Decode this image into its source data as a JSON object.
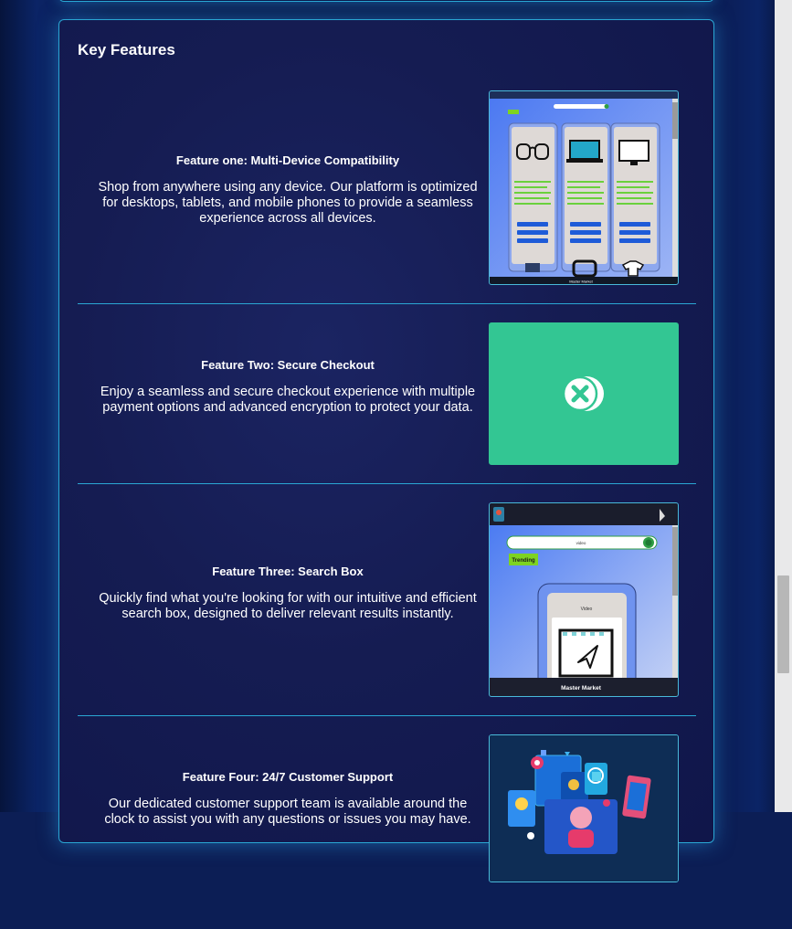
{
  "section": {
    "title": "Key Features"
  },
  "features": [
    {
      "title": "Feature one: Multi-Device Compatibility",
      "description": "Shop from anywhere using any device. Our platform is optimized for desktops, tablets, and mobile phones to provide a seamless experience across all devices.",
      "image_label": "Master Market"
    },
    {
      "title": "Feature Two: Secure Checkout",
      "description": "Enjoy a seamless and secure checkout experience with multiple payment options and advanced encryption to protect your data.",
      "image_icon": "secure-checkout-icon"
    },
    {
      "title": "Feature Three: Search Box",
      "description": "Quickly find what you're looking for with our intuitive and efficient search box, designed to deliver relevant results instantly.",
      "image_search_text": "video",
      "image_trending": "Trending",
      "image_card_label": "Video",
      "image_footer": "Master Market"
    },
    {
      "title": "Feature Four: 24/7 Customer Support",
      "description": "Our dedicated customer support team is available around the clock to assist you with any questions or issues you may have."
    }
  ],
  "colors": {
    "accent_border": "#2aa7d4",
    "checkout_green": "#33c693",
    "trending_green": "#7ed321"
  }
}
